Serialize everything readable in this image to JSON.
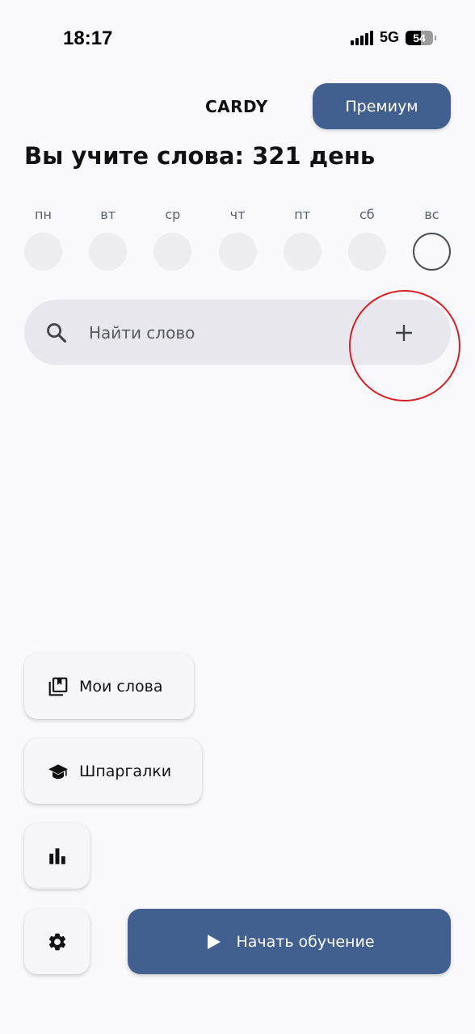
{
  "status_bar": {
    "time": "18:17",
    "network": "5G",
    "battery": "54"
  },
  "header": {
    "app_title": "CARDY",
    "premium_label": "Премиум"
  },
  "streak": {
    "title": "Вы учите слова: 321 день"
  },
  "week": {
    "days": [
      "пн",
      "вт",
      "ср",
      "чт",
      "пт",
      "сб",
      "вс"
    ],
    "today_index": 6
  },
  "search": {
    "placeholder": "Найти слово",
    "value": ""
  },
  "menu": {
    "my_words_label": "Мои слова",
    "cheat_sheets_label": "Шпаргалки",
    "start_label": "Начать обучение"
  },
  "icons": {
    "search": "search-icon",
    "add": "plus-icon",
    "my_words": "bookmark-stack-icon",
    "cheat_sheets": "graduation-cap-icon",
    "stats": "bar-chart-icon",
    "settings": "gear-icon",
    "start": "play-icon"
  },
  "colors": {
    "accent": "#41608f",
    "background": "#f9f8fd",
    "highlight": "#d71f22"
  }
}
